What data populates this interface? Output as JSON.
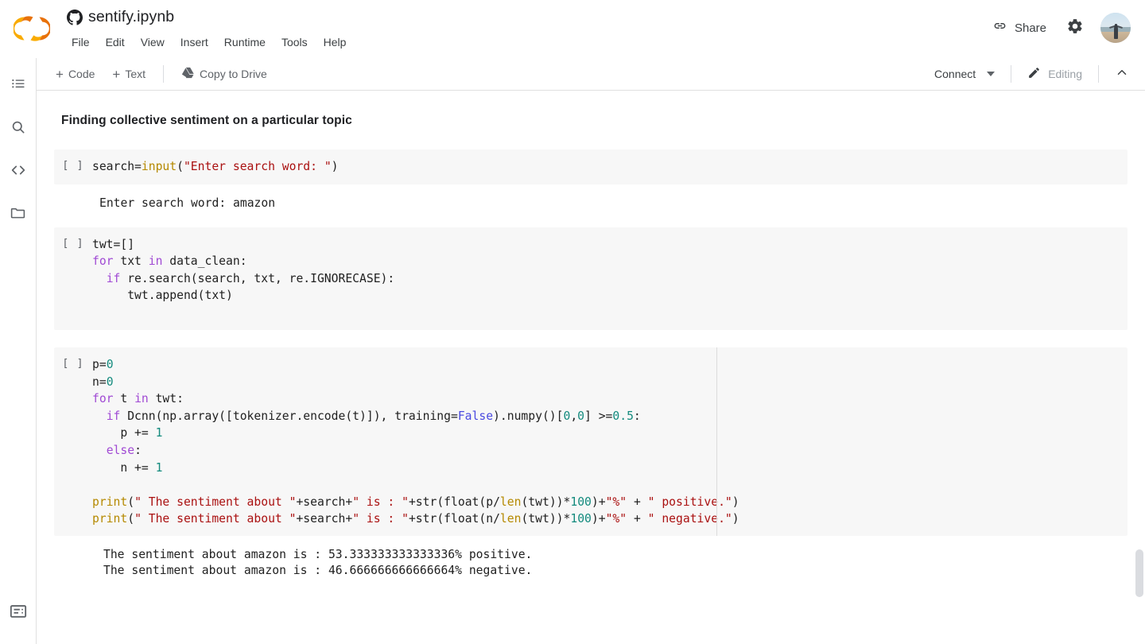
{
  "header": {
    "logo_name": "colab-logo",
    "logo_colors": {
      "light": "#F9AB00",
      "dark": "#E8710A"
    },
    "source_icon": "github-icon",
    "doc_title": "sentify.ipynb",
    "menus": [
      "File",
      "Edit",
      "View",
      "Insert",
      "Runtime",
      "Tools",
      "Help"
    ],
    "share_label": "Share",
    "share_icon": "link-icon",
    "settings_icon": "gear-icon",
    "avatar_name": "user-avatar"
  },
  "toolbar": {
    "add_code_label": "Code",
    "add_text_label": "Text",
    "copy_to_drive_label": "Copy to Drive",
    "drive_icon": "drive-icon",
    "connect_label": "Connect",
    "editing_label": "Editing",
    "editing_icon": "pencil-icon",
    "collapse_icon": "chevron-up-icon",
    "dropdown_icon": "chevron-down-icon"
  },
  "rail": {
    "items": [
      {
        "name": "toc-icon",
        "label": "Table of contents"
      },
      {
        "name": "search-icon",
        "label": "Find and replace"
      },
      {
        "name": "code-snippets-icon",
        "label": "Code snippets"
      },
      {
        "name": "files-icon",
        "label": "Files"
      }
    ],
    "bottom": {
      "name": "terminal-icon",
      "label": "Terminal"
    }
  },
  "notebook": {
    "heading": "Finding collective sentiment on a particular topic",
    "run_marker": "[ ]",
    "cells": [
      {
        "id": "cell-input-search",
        "output": "Enter search word: amazon"
      },
      {
        "id": "cell-filter-tweets",
        "output": null
      },
      {
        "id": "cell-sentiment-count",
        "output_line_1": "The sentiment about amazon is : 53.333333333333336% positive.",
        "output_line_2": "The sentiment about amazon is : 46.666666666666664% negative."
      }
    ],
    "code": {
      "cell1_line1_a": "search=",
      "cell1_line1_b": "input",
      "cell1_line1_c": "(",
      "cell1_line1_d": "\"Enter search word: \"",
      "cell1_line1_e": ")",
      "cell2": "twt=[]\nfor txt in data_clean:\n  if re.search(search, txt, re.IGNORECASE):\n     twt.append(txt)",
      "cell3": "p=0\nn=0\nfor t in twt:\n  if Dcnn(np.array([tokenizer.encode(t)]), training=False).numpy()[0,0] >=0.5:\n    p += 1\n  else:\n    n += 1\n\nprint(\" The sentiment about \"+search+\" is : \"+str(float(p/len(twt))*100)+\"%\" + \" positive.\")\nprint(\" The sentiment about \"+search+\" is : \"+str(float(n/len(twt))*100)+\"%\" + \" negative.\")"
    }
  },
  "scrollbar": {
    "name": "vertical-scrollbar"
  }
}
